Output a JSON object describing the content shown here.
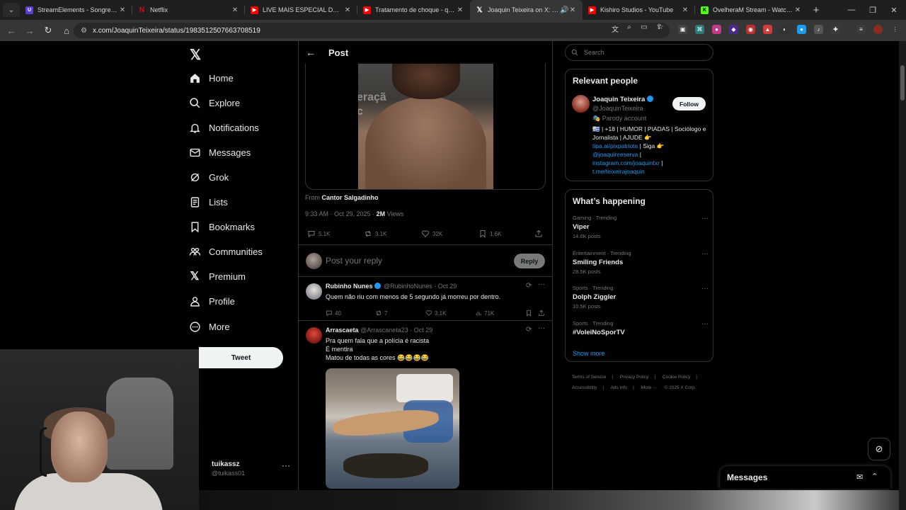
{
  "browser": {
    "tabs": [
      {
        "title": "StreamElements - Songrequest",
        "icon": "streamelements-icon",
        "color": "#5a3fd1"
      },
      {
        "title": "Netflix",
        "icon": "netflix-icon",
        "color": "#e50914"
      },
      {
        "title": "LIVE MAIS ESPECIAL DO ANO!!",
        "icon": "youtube-icon",
        "color": "#ff0000"
      },
      {
        "title": "Tratamento de choque - qualqu",
        "icon": "youtube-icon",
        "color": "#ff0000"
      },
      {
        "title": "Joaquin Teixeira on X: \"Tira",
        "icon": "x-icon",
        "color": "#000000"
      },
      {
        "title": "Kishiro Studios - YouTube",
        "icon": "youtube-icon",
        "color": "#ff0000"
      },
      {
        "title": "OvelheraM Stream - Watch Live",
        "icon": "kick-icon",
        "color": "#53fc18"
      }
    ],
    "url": "x.com/JoaquinTeixeira/status/1983512507663708519"
  },
  "nav": {
    "items": [
      {
        "label": "Home",
        "icon": "home-icon"
      },
      {
        "label": "Explore",
        "icon": "search-icon"
      },
      {
        "label": "Notifications",
        "icon": "bell-icon"
      },
      {
        "label": "Messages",
        "icon": "envelope-icon"
      },
      {
        "label": "Grok",
        "icon": "grok-icon"
      },
      {
        "label": "Lists",
        "icon": "list-icon"
      },
      {
        "label": "Bookmarks",
        "icon": "bookmark-icon"
      },
      {
        "label": "Communities",
        "icon": "people-icon"
      },
      {
        "label": "Premium",
        "icon": "x-icon"
      },
      {
        "label": "Profile",
        "icon": "person-icon"
      },
      {
        "label": "More",
        "icon": "more-circle-icon"
      }
    ],
    "tweet_label": "Tweet",
    "account": {
      "name": "tuikassz",
      "handle": "@tuikass01"
    }
  },
  "post": {
    "header_title": "Post",
    "video_overlay_text": "eraçã\nc",
    "from_prefix": "From",
    "from_name": "Cantor Salgadinho",
    "time": "9:33 AM · Oct 29, 2025 · ",
    "views_value": "2M",
    "views_label": " Views",
    "stats": {
      "replies": "5.1K",
      "reposts": "3.1K",
      "likes": "32K",
      "bookmarks": "1.6K"
    },
    "reply_placeholder": "Post your reply",
    "reply_button": "Reply"
  },
  "replies": [
    {
      "name": "Rubinho Nunes",
      "verified": true,
      "handle": "@RubinhoNunes · Oct 29",
      "text": "Quem não riu com menos de 5 segundo já morreu por dentro.",
      "replies": "40",
      "reposts": "7",
      "likes": "3.1K",
      "views": "71K"
    },
    {
      "name": "Arrascaeta",
      "verified": false,
      "handle": "@Arrascaneta23 · Oct 29",
      "line1": "Pra quem fala que a polícia é racista",
      "line2": "É mentira",
      "line3": "Matou de todas as cores 😂😂😂😂"
    }
  ],
  "sidebar": {
    "search_placeholder": "Search",
    "relevant": {
      "title": "Relevant people",
      "name": "Joaquin Teixeira",
      "handle": "@JoaquinTeixeira",
      "follow": "Follow",
      "parody": "🎭 Parody account",
      "bio_line1": "🇺🇾 | +18 | HUMOR | PIADAS | Sociólogo e Jornalista | AJUDE 👉",
      "bio_link1": "tipa.ai/pixpatriota",
      "bio_mid": " | Siga 👉",
      "bio_link2": "@joaquinreserva",
      "bio_sep": " | ",
      "bio_link3": "instagram.com/joaquintxr",
      "bio_link4": "t.me/teixeirajoaquin"
    },
    "happening": {
      "title": "What’s happening",
      "trends": [
        {
          "category": "Gaming · Trending",
          "name": "Viper",
          "count": "14.6K posts"
        },
        {
          "category": "Entertainment · Trending",
          "name": "Smiling Friends",
          "count": "28.5K posts"
        },
        {
          "category": "Sports · Trending",
          "name": "Dolph Ziggler",
          "count": "10.5K posts"
        },
        {
          "category": "Sports · Trending",
          "name": "#VoleiNoSporTV",
          "count": ""
        }
      ],
      "show_more": "Show more"
    },
    "footer": [
      "Terms of Service",
      "|",
      "Privacy Policy",
      "|",
      "Cookie Policy",
      "|",
      "Accessibility",
      "|",
      "Ads info",
      "|",
      "More ···",
      "© 2025 X Corp."
    ]
  },
  "messages_drawer": {
    "title": "Messages"
  },
  "colors": {
    "accent": "#1d9bf0",
    "background": "#000000",
    "border": "#2f3336",
    "muted": "#71767b"
  }
}
